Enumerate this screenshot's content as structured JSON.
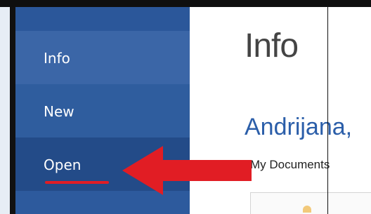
{
  "sidebar": {
    "items": [
      {
        "label": "Info"
      },
      {
        "label": "New"
      },
      {
        "label": "Open"
      }
    ]
  },
  "content": {
    "title": "Info",
    "account_name": "Andrijana,",
    "location_label": "My Documents"
  },
  "colors": {
    "sidebar_blue": "#2b579a",
    "accent_red": "#e11d24",
    "link_blue": "#2b5ea9"
  },
  "icons": {
    "annotation": "arrow-left-icon",
    "document": "folder-icon"
  }
}
